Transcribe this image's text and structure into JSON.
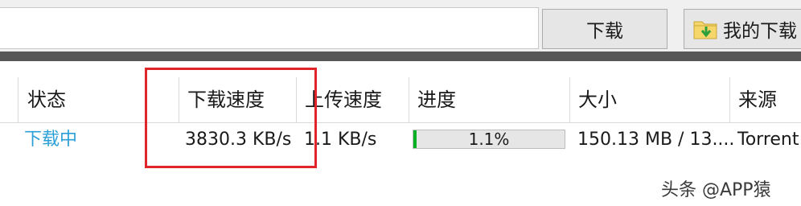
{
  "toolbar": {
    "url_value": "",
    "download_label": "下载",
    "my_downloads_label": "我的下载"
  },
  "table": {
    "columns": [
      "状态",
      "下载速度",
      "上传速度",
      "进度",
      "大小",
      "来源"
    ],
    "row": {
      "status": "下载中",
      "download_speed": "3830.3 KB/s",
      "upload_speed": "1.1 KB/s",
      "progress_text": "1.1%",
      "progress_value": 0.011,
      "size": "150.13 MB / 13....",
      "source": "Torrent"
    }
  },
  "watermark": "头条 @APP猿",
  "colors": {
    "status_text": "#2b9fd8",
    "progress_fill": "#06b025",
    "highlight_border": "#e0252b",
    "dark_band": "#575757"
  },
  "icons": {
    "my_downloads": "folder-download-icon"
  }
}
